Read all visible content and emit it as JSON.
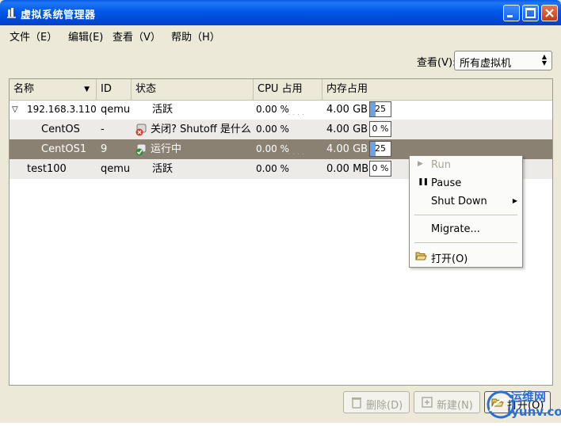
{
  "window": {
    "title": "虚拟系统管理器"
  },
  "menubar": {
    "file": "文件（E）",
    "edit": "编辑(E)",
    "view": "查看（V）",
    "help": "帮助（H）"
  },
  "toolbar": {
    "view_label": "查看(V):",
    "view_select": "所有虚拟机"
  },
  "table": {
    "headers": [
      "名称",
      "ID",
      "状态",
      "CPU 占用",
      "内存占用"
    ],
    "rows": [
      {
        "name": "192.168.3.110",
        "id": "qemu",
        "status": "活跃",
        "cpu": "0.00 %",
        "mem": "4.00 GB",
        "mem_pct": "25 %",
        "mem_fraction": 0.25
      },
      {
        "name": "CentOS",
        "id": "-",
        "status": "关闭? Shutoff 是什么",
        "cpu": "0.00 %",
        "mem": "4.00 GB",
        "mem_pct": "0 %",
        "mem_fraction": 0.0
      },
      {
        "name": "CentOS1",
        "id": "9",
        "status": "运行中",
        "cpu": "0.00 %",
        "mem": "4.00 GB",
        "mem_pct": "25 %",
        "mem_fraction": 0.25
      },
      {
        "name": "test100",
        "id": "qemu",
        "status": "活跃",
        "cpu": "0.00 %",
        "mem": "0.00 MB",
        "mem_pct": "0 %",
        "mem_fraction": 0.0
      }
    ]
  },
  "context_menu": {
    "run": "Run",
    "pause": "Pause",
    "shutdown": "Shut Down",
    "migrate": "Migrate...",
    "open": "打开(O)"
  },
  "buttons": {
    "delete": "删除(D)",
    "new": "新建(N)",
    "open": "打开(O)"
  },
  "watermark": {
    "line1": "运维网",
    "line2": "iyunv.com"
  },
  "colors": {
    "title_blue": "#0058e8",
    "selected_row": "#8b8173",
    "memory_fill": "#6ea2e8",
    "stopped_icon": "#d83a2a",
    "running_icon": "#2e8b3a"
  }
}
